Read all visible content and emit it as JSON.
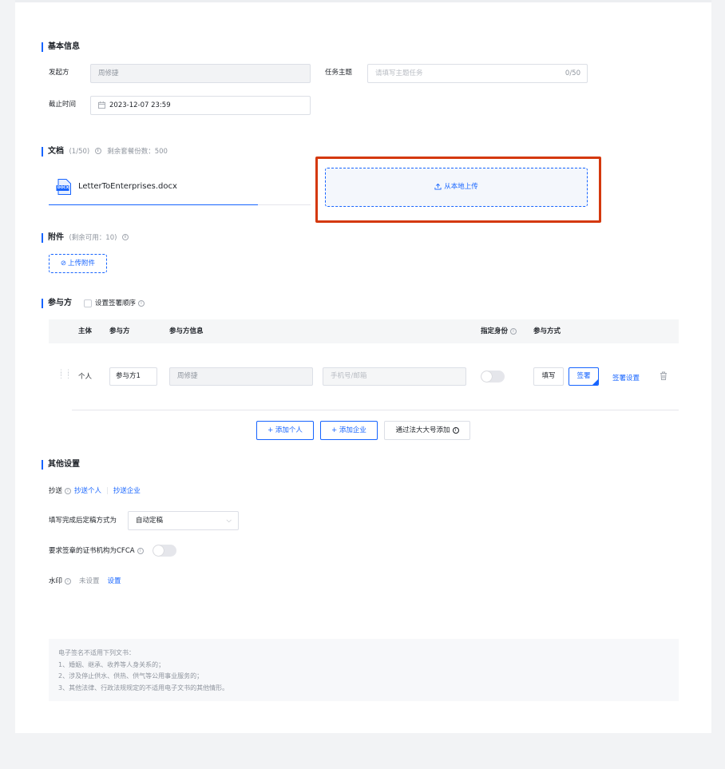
{
  "basic": {
    "title": "基本信息",
    "initiator_label": "发起方",
    "initiator_value": "周修捷",
    "subject_label": "任务主题",
    "subject_placeholder": "请填写主题任务",
    "subject_count": "0/50",
    "deadline_label": "截止时间",
    "deadline_value": "2023-12-07 23:59"
  },
  "docs": {
    "title": "文档",
    "count": "(1/50)",
    "remaining": "剩余套餐份数：500",
    "file_name": "LetterToEnterprises.docx",
    "file_icon_text": "DOCX",
    "upload_label": "从本地上传"
  },
  "attachments": {
    "title": "附件",
    "remaining": "(剩余可用：10)",
    "upload_label": "上传附件"
  },
  "participants": {
    "title": "参与方",
    "order_label": "设置签署顺序",
    "headers": {
      "subject": "主体",
      "party": "参与方",
      "party_info": "参与方信息",
      "identity": "指定身份",
      "method": "参与方式"
    },
    "row": {
      "subject": "个人",
      "party_name": "参与方1",
      "person_name": "周修捷",
      "contact_placeholder": "手机号/邮箱",
      "fill_label": "填写",
      "sign_label": "签署",
      "sign_settings": "签署设置"
    },
    "add_person": "+ 添加个人",
    "add_company": "+ 添加企业",
    "add_by_legal": "通过法大大号添加"
  },
  "other": {
    "title": "其他设置",
    "cc_label": "抄送",
    "cc_person": "抄送个人",
    "cc_company": "抄送企业",
    "finalize_label": "填写完成后定稿方式为",
    "finalize_value": "自动定稿",
    "cfca_label": "要求签章的证书机构为CFCA",
    "watermark_label": "水印",
    "watermark_status": "未设置",
    "watermark_link": "设置"
  },
  "notice": {
    "lines": [
      "电子签名不适用下列文书：",
      "1、婚姻、继承、收养等人身关系的；",
      "2、涉及停止供水、供热、供气等公用事业服务的；",
      "3、其他法律、行政法规规定的不适用电子文书的其他情形。"
    ]
  },
  "colors": {
    "accent": "#1664ff",
    "highlight_box": "#d4380d"
  }
}
